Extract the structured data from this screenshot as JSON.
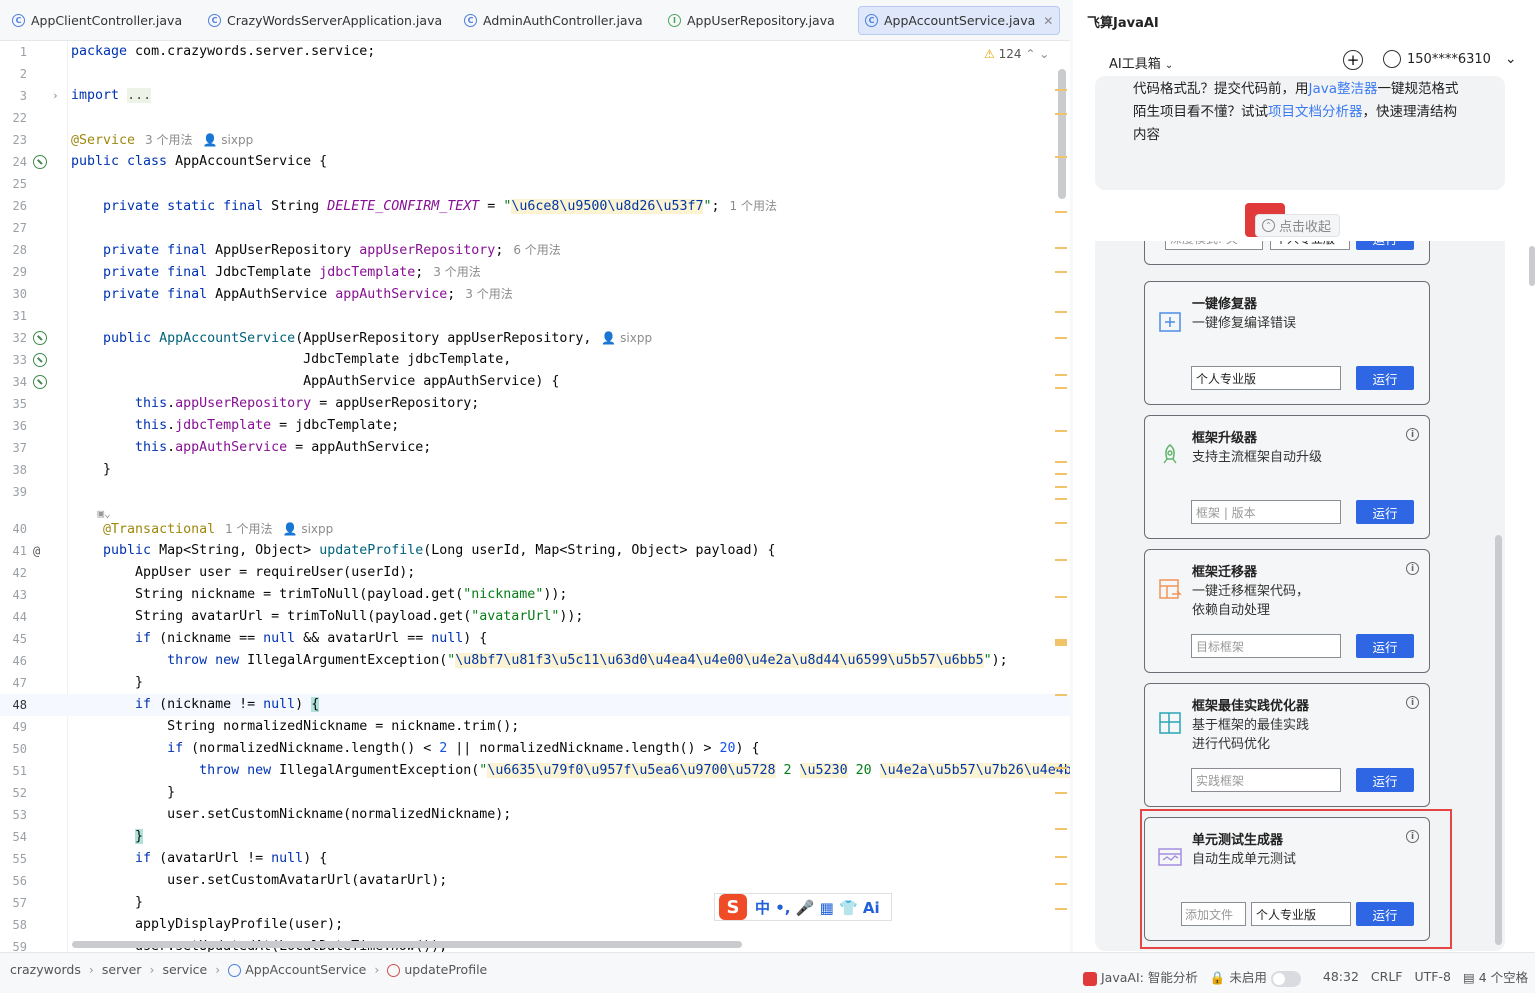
{
  "tabs": [
    {
      "label": "AppClientController.java",
      "active": false
    },
    {
      "label": "CrazyWordsServerApplication.java",
      "active": false
    },
    {
      "label": "AdminAuthController.java",
      "active": false
    },
    {
      "label": "AppUserRepository.java",
      "active": false
    },
    {
      "label": "AppAccountService.java",
      "active": true
    }
  ],
  "editor": {
    "warnings_count": "124",
    "current_line": "48"
  },
  "hints": {
    "usages_3": "3 个用法",
    "usages_1": "1 个用法",
    "usages_6": "6 个用法",
    "author": "sixpp"
  },
  "ime": {
    "chars": "中 •, 🎤 ▦ 👕 Ai"
  },
  "status": {
    "breadcrumb": [
      "crazywords",
      "server",
      "service",
      "AppAccountService",
      "updateProfile"
    ],
    "javaai": "JavaAI: 智能分析",
    "lock": "未启用",
    "position": "48:32",
    "line_sep": "CRLF",
    "encoding": "UTF-8",
    "indent": "4 个空格"
  },
  "panel": {
    "title": "飞算JavaAI",
    "tools_label": "AI工具箱",
    "user": "150****6310",
    "tip_line1_pre": "代码格式乱？提交代码前，用",
    "tip_line1_link": "Java整洁器",
    "tip_line1_post": "一键规范格式",
    "tip_line2_pre": "陌生项目看不懂？试试",
    "tip_line2_link": "项目文档分析器",
    "tip_line2_post": "，快速理清结构内容",
    "collapse_label": "点击收起",
    "cards": [
      {
        "name": "一键修复器",
        "desc": "一键修复编译错误",
        "input": "个人专业版",
        "run": "运行"
      },
      {
        "name": "框架升级器",
        "desc": "支持主流框架自动升级",
        "input": "框架 | 版本",
        "run": "运行"
      },
      {
        "name": "框架迁移器",
        "desc": "一键迁移框架代码，\n依赖自动处理",
        "input": "目标框架",
        "run": "运行"
      },
      {
        "name": "框架最佳实践优化器",
        "desc": "基于框架的最佳实践\n进行代码优化",
        "input": "实践框架",
        "run": "运行"
      },
      {
        "name": "单元测试生成器",
        "desc": "自动生成单元测试",
        "addfile": "添加文件",
        "input": "个人专业版",
        "run": "运行"
      }
    ],
    "partial_card": {
      "input_a": "深度模式: 关",
      "input_b": "个人专业版",
      "run": "运行"
    }
  }
}
